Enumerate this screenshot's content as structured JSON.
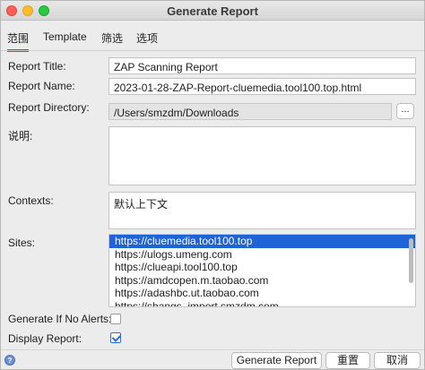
{
  "window": {
    "title": "Generate Report"
  },
  "tabs": [
    {
      "label": "范围",
      "active": true
    },
    {
      "label": "Template",
      "active": false
    },
    {
      "label": "筛选",
      "active": false
    },
    {
      "label": "选项",
      "active": false
    }
  ],
  "form": {
    "report_title": {
      "label": "Report Title:",
      "value": "ZAP Scanning Report"
    },
    "report_name": {
      "label": "Report Name:",
      "value": "2023-01-28-ZAP-Report-cluemedia.tool100.top.html"
    },
    "report_directory": {
      "label": "Report Directory:",
      "value": "/Users/smzdm/Downloads",
      "browse_label": "..."
    },
    "description": {
      "label": "说明:",
      "value": ""
    },
    "contexts": {
      "label": "Contexts:",
      "value": "默认上下文"
    },
    "sites": {
      "label": "Sites:",
      "items": [
        "https://cluemedia.tool100.top",
        "https://ulogs.umeng.com",
        "https://clueapi.tool100.top",
        "https://amdcopen.m.taobao.com",
        "https://adashbc.ut.taobao.com",
        "https://shangs_import.smzdm.com"
      ]
    },
    "generate_if_no_alerts": {
      "label": "Generate If No Alerts:",
      "checked": false
    },
    "display_report": {
      "label": "Display Report:",
      "checked": true
    }
  },
  "buttons": {
    "help_icon": "help-icon",
    "generate": "Generate Report",
    "reset": "重置",
    "cancel": "取消"
  },
  "colors": {
    "accent": "#1f6fe5",
    "selection": "#1f63d6"
  }
}
